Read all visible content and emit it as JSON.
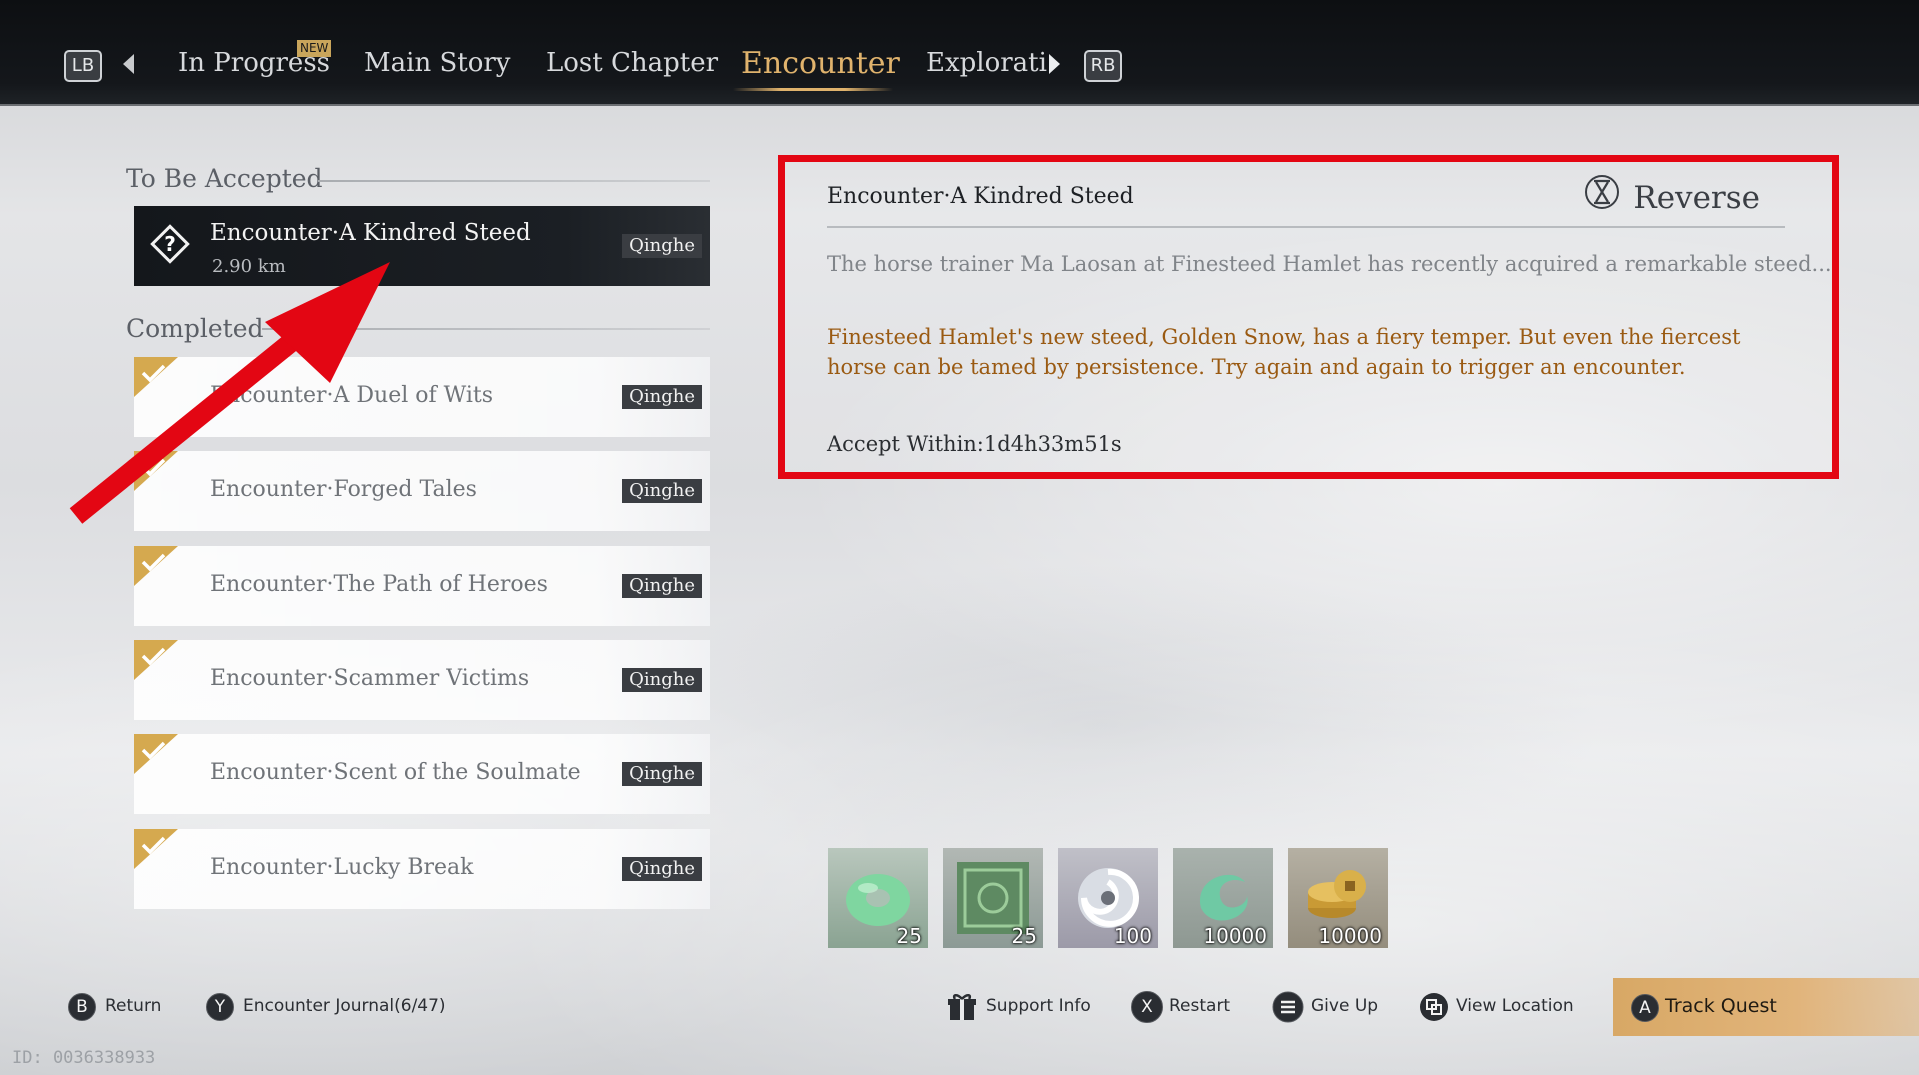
{
  "top_nav": {
    "lb": "LB",
    "rb": "RB",
    "new_badge": "NEW",
    "tabs": [
      {
        "label": "In Progress"
      },
      {
        "label": "Main Story"
      },
      {
        "label": "Lost Chapter"
      },
      {
        "label": "Encounter"
      },
      {
        "label": "Explorati"
      }
    ],
    "active_tab": "Encounter"
  },
  "quest_list": {
    "to_be_accepted_label": "To Be Accepted",
    "completed_label": "Completed",
    "active": {
      "title": "Encounter·A Kindred Steed",
      "distance": "2.90 km",
      "region": "Qinghe"
    },
    "completed": [
      {
        "title": "Encounter·A Duel of Wits",
        "region": "Qinghe"
      },
      {
        "title": "Encounter·Forged Tales",
        "region": "Qinghe"
      },
      {
        "title": "Encounter·The Path of Heroes",
        "region": "Qinghe"
      },
      {
        "title": "Encounter·Scammer Victims",
        "region": "Qinghe"
      },
      {
        "title": "Encounter·Scent of the Soulmate",
        "region": "Qinghe"
      },
      {
        "title": "Encounter·Lucky Break",
        "region": "Qinghe"
      }
    ]
  },
  "detail": {
    "title": "Encounter·A Kindred Steed",
    "reverse_label": "Reverse",
    "intro": "The horse trainer Ma Laosan at Finesteed Hamlet has recently acquired a remarkable steed...",
    "hint": "Finesteed Hamlet's new steed, Golden Snow, has a fiery temper. But even the fiercest horse can be tamed by persistence. Try again and again to trigger an encounter.",
    "accept_within": "Accept Within:1d4h33m51s"
  },
  "rewards": [
    {
      "icon": "jade-ring-icon",
      "qty": "25"
    },
    {
      "icon": "green-tome-icon",
      "qty": "25"
    },
    {
      "icon": "swirl-orb-icon",
      "qty": "100"
    },
    {
      "icon": "green-wind-icon",
      "qty": "10000"
    },
    {
      "icon": "coin-stack-icon",
      "qty": "10000"
    }
  ],
  "bottom_bar": {
    "return_key": "B",
    "return_label": "Return",
    "journal_key": "Y",
    "journal_label": "Encounter Journal(6/47)",
    "support_label": "Support Info",
    "restart_key": "X",
    "restart_label": "Restart",
    "giveup_label": "Give Up",
    "view_location_label": "View Location",
    "track_key": "A",
    "track_label": "Track Quest"
  },
  "watermark": "ID: 0036338933",
  "colors": {
    "accent_gold": "#e0b36d",
    "hint_brown": "#9a5a12",
    "highlight_red": "#e30613",
    "track_bg": "#d8a865"
  }
}
